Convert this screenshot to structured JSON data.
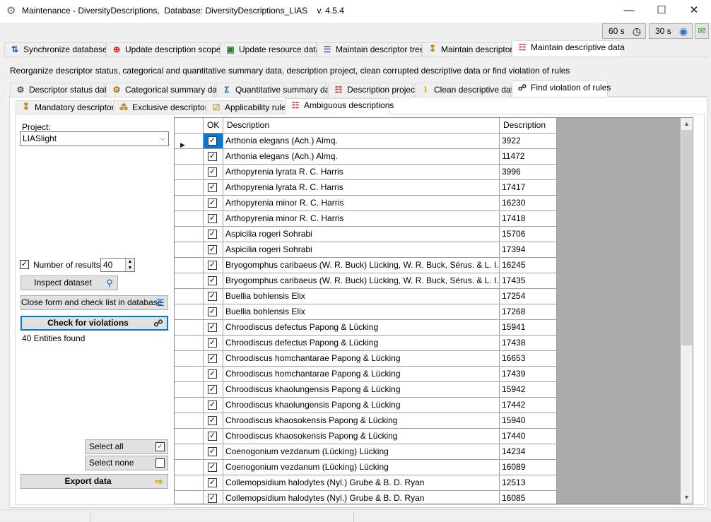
{
  "window": {
    "title": "Maintenance - DiversityDescriptions,  Database: DiversityDescriptions_LIAS    v. 4.5.4",
    "minimize": "—",
    "maximize": "☐",
    "close": "✕"
  },
  "timers": [
    {
      "label": "60 s",
      "icon": "clock-icon"
    },
    {
      "label": "30 s",
      "icon": "globe-icon"
    }
  ],
  "main_tabs": [
    {
      "label": "Synchronize databases",
      "icon": "sync-icon"
    },
    {
      "label": "Update description scopes",
      "icon": "target-icon"
    },
    {
      "label": "Update resource data",
      "icon": "image-icon"
    },
    {
      "label": "Maintain descriptor trees",
      "icon": "tree-icon"
    },
    {
      "label": "Maintain descriptors",
      "icon": "descriptor-icon"
    },
    {
      "label": "Maintain descriptive data",
      "icon": "data-icon"
    }
  ],
  "description": "Reorganize descriptor status, categorical and quantitative summary data, description project, clean corrupted descriptive data or find violation of rules",
  "sub_tabs": [
    {
      "label": "Descriptor status data",
      "icon": "gear-icon"
    },
    {
      "label": "Categorical summary data",
      "icon": "categorical-icon"
    },
    {
      "label": "Quantitative summary data",
      "icon": "sigma-icon"
    },
    {
      "label": "Description project",
      "icon": "project-icon"
    },
    {
      "label": "Clean descriptive data",
      "icon": "broom-icon"
    },
    {
      "label": "Find violation of rules",
      "icon": "binoculars-icon"
    }
  ],
  "rule_tabs": [
    {
      "label": "Mandatory descriptors",
      "icon": "mandatory-icon"
    },
    {
      "label": "Exclusive descriptors",
      "icon": "exclusive-icon"
    },
    {
      "label": "Applicability rules",
      "icon": "applicability-icon"
    },
    {
      "label": "Ambiguous descriptions",
      "icon": "ambiguous-icon"
    }
  ],
  "left": {
    "project_label": "Project:",
    "project_value": "LIASlight",
    "number_of_results_label": "Number of results:",
    "number_of_results_checked": "✓",
    "number_of_results_value": "40",
    "inspect_button": "Inspect dataset",
    "close_form_button": "Close form and check list in database",
    "check_button": "Check for violations",
    "entities_found": "40 Entities found",
    "select_all_button": "Select all",
    "select_none_button": "Select none",
    "export_button": "Export data"
  },
  "grid": {
    "headers": {
      "ok": "OK",
      "description": "Description",
      "id": "Description ID"
    },
    "rows": [
      {
        "description": "Arthonia elegans (Ach.) Almq.",
        "id": "3922"
      },
      {
        "description": "Arthonia elegans (Ach.) Almq.",
        "id": "11472"
      },
      {
        "description": "Arthopyrenia lyrata R. C. Harris",
        "id": "3996"
      },
      {
        "description": "Arthopyrenia lyrata R. C. Harris",
        "id": "17417"
      },
      {
        "description": "Arthopyrenia minor R. C. Harris",
        "id": "16230"
      },
      {
        "description": "Arthopyrenia minor R. C. Harris",
        "id": "17418"
      },
      {
        "description": "Aspicilia rogeri Sohrabi",
        "id": "15706"
      },
      {
        "description": "Aspicilia rogeri Sohrabi",
        "id": "17394"
      },
      {
        "description": "Bryogomphus caribaeus (W. R. Buck) Lücking, W. R. Buck, Sérus. & L. I. Ferraro",
        "id": "16245"
      },
      {
        "description": "Bryogomphus caribaeus (W. R. Buck) Lücking, W. R. Buck, Sérus. & L. I. Ferraro",
        "id": "17435"
      },
      {
        "description": "Buellia bohlensis Elix",
        "id": "17254"
      },
      {
        "description": "Buellia bohlensis Elix",
        "id": "17268"
      },
      {
        "description": "Chroodiscus defectus Papong & Lücking",
        "id": "15941"
      },
      {
        "description": "Chroodiscus defectus Papong & Lücking",
        "id": "17438"
      },
      {
        "description": "Chroodiscus homchantarae Papong & Lücking",
        "id": "16653"
      },
      {
        "description": "Chroodiscus homchantarae Papong & Lücking",
        "id": "17439"
      },
      {
        "description": "Chroodiscus khaolungensis Papong & Lücking",
        "id": "15942"
      },
      {
        "description": "Chroodiscus khaolungensis Papong & Lücking",
        "id": "17442"
      },
      {
        "description": "Chroodiscus khaosokensis Papong & Lücking",
        "id": "15940"
      },
      {
        "description": "Chroodiscus khaosokensis Papong & Lücking",
        "id": "17440"
      },
      {
        "description": "Coenogonium vezdanum (Lücking) Lücking",
        "id": "14234"
      },
      {
        "description": "Coenogonium vezdanum (Lücking) Lücking",
        "id": "16089"
      },
      {
        "description": "Collemopsidium halodytes (Nyl.) Grube & B. D. Ryan",
        "id": "12513"
      },
      {
        "description": "Collemopsidium halodytes (Nyl.) Grube & B. D. Ryan",
        "id": "16085"
      }
    ],
    "check_mark": "✓",
    "current_row_marker": "▶"
  },
  "scrollbar": {
    "up": "▲",
    "down": "▼"
  },
  "colors": {
    "selection": "#0078d7",
    "grid_background": "#ababab"
  }
}
